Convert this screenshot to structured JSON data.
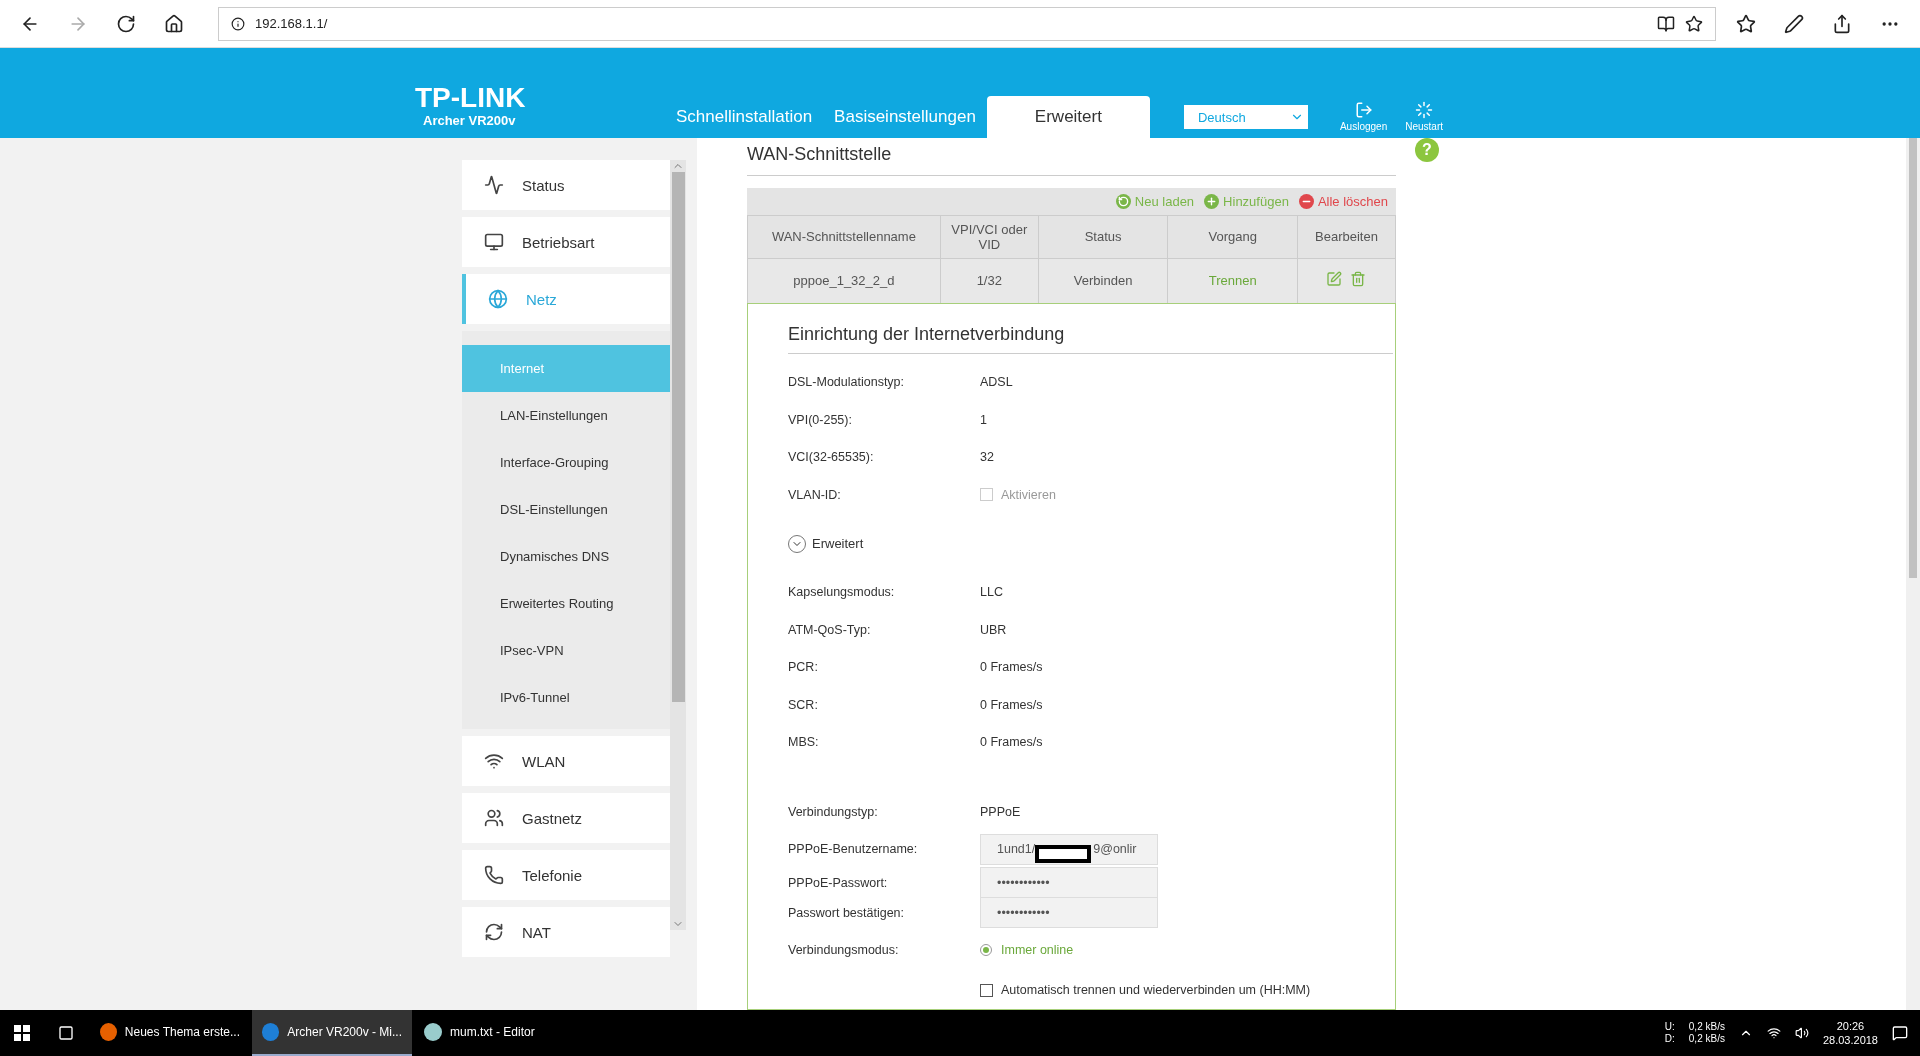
{
  "browser": {
    "url": "192.168.1.1/"
  },
  "header": {
    "logo": "TP-LINK",
    "model": "Archer VR200v",
    "tabs": [
      {
        "label": "Schnellinstallation",
        "selected": false
      },
      {
        "label": "Basiseinstellungen",
        "selected": false
      },
      {
        "label": "Erweitert",
        "selected": true
      }
    ],
    "language": "Deutsch",
    "actions": [
      "Ausloggen",
      "Neustart"
    ]
  },
  "sidebar": {
    "items": [
      {
        "label": "Status",
        "selected": false
      },
      {
        "label": "Betriebsart",
        "selected": false
      },
      {
        "label": "Netz",
        "selected": true,
        "expanded": true,
        "children": [
          {
            "label": "Internet",
            "selected": true
          },
          {
            "label": "LAN-Einstellungen",
            "selected": false
          },
          {
            "label": "Interface-Grouping",
            "selected": false
          },
          {
            "label": "DSL-Einstellungen",
            "selected": false
          },
          {
            "label": "Dynamisches DNS",
            "selected": false
          },
          {
            "label": "Erweitertes Routing",
            "selected": false
          },
          {
            "label": "IPsec-VPN",
            "selected": false
          },
          {
            "label": "IPv6-Tunnel",
            "selected": false
          }
        ]
      },
      {
        "label": "WLAN",
        "selected": false
      },
      {
        "label": "Gastnetz",
        "selected": false
      },
      {
        "label": "Telefonie",
        "selected": false
      },
      {
        "label": "NAT",
        "selected": false
      }
    ]
  },
  "main": {
    "title": "WAN-Schnittstelle",
    "help": "?",
    "toolbar": [
      {
        "label": "Neu laden",
        "color": "#7ab648"
      },
      {
        "label": "Hinzufügen",
        "color": "#7ab648"
      },
      {
        "label": "Alle löschen",
        "color": "#e0474c"
      }
    ],
    "table": {
      "columns": [
        "WAN-Schnittstellenname",
        "VPI/VCI oder VID",
        "Status",
        "Vorgang",
        "Bearbeiten"
      ],
      "rows": [
        {
          "name": "pppoe_1_32_2_d",
          "vpi": "1/32",
          "status": "Verbinden",
          "action": "Trennen",
          "selected": true
        }
      ]
    },
    "setup": {
      "title": "Einrichtung der Internetverbindung",
      "basic": [
        {
          "kind": "text",
          "label": "DSL-Modulationstyp:",
          "value": "ADSL"
        },
        {
          "kind": "text",
          "label": "VPI(0-255):",
          "value": "1"
        },
        {
          "kind": "text",
          "label": "VCI(32-65535):",
          "value": "32"
        },
        {
          "kind": "checkbox",
          "label": "VLAN-ID:",
          "option": "Aktivieren",
          "checked": false,
          "disabled": true
        }
      ],
      "advanced": {
        "label": "Erweitert",
        "expanded": true,
        "rows": [
          {
            "kind": "text",
            "label": "Kapselungsmodus:",
            "value": "LLC"
          },
          {
            "kind": "text",
            "label": "ATM-QoS-Typ:",
            "value": "UBR"
          },
          {
            "kind": "text",
            "label": "PCR:",
            "value": "0 Frames/s"
          },
          {
            "kind": "text",
            "label": "SCR:",
            "value": "0 Frames/s"
          },
          {
            "kind": "text",
            "label": "MBS:",
            "value": "0 Frames/s"
          }
        ]
      },
      "connection": [
        {
          "kind": "text",
          "label": "Verbindungstyp:",
          "value": "PPPoE"
        },
        {
          "kind": "redacted",
          "label": "PPPoE-Benutzername:",
          "value_start": "1und1/",
          "value_end": "9@onlir"
        },
        {
          "kind": "field",
          "label": "PPPoE-Passwort:",
          "value": "••••••••••••"
        },
        {
          "kind": "field",
          "label": "Passwort bestätigen:",
          "value": "••••••••••••"
        },
        {
          "kind": "radio",
          "label": "Verbindungsmodus:",
          "option": "Immer online",
          "checked": true
        },
        {
          "kind": "checkbox",
          "option": "Automatisch trennen und wiederverbinden um (HH:MM)",
          "checked": false,
          "disabled": false
        }
      ]
    }
  },
  "taskbar": {
    "apps": [
      {
        "label": "Neues Thema erste...",
        "selected": false
      },
      {
        "label": "Archer VR200v - Mi...",
        "selected": true
      },
      {
        "label": "mum.txt - Editor",
        "selected": false
      }
    ],
    "net": {
      "up_label": "U:",
      "up": "0,2 kB/s",
      "down_label": "D:",
      "down": "0,2 kB/s"
    },
    "time": "20:26",
    "date": "28.03.2018"
  }
}
